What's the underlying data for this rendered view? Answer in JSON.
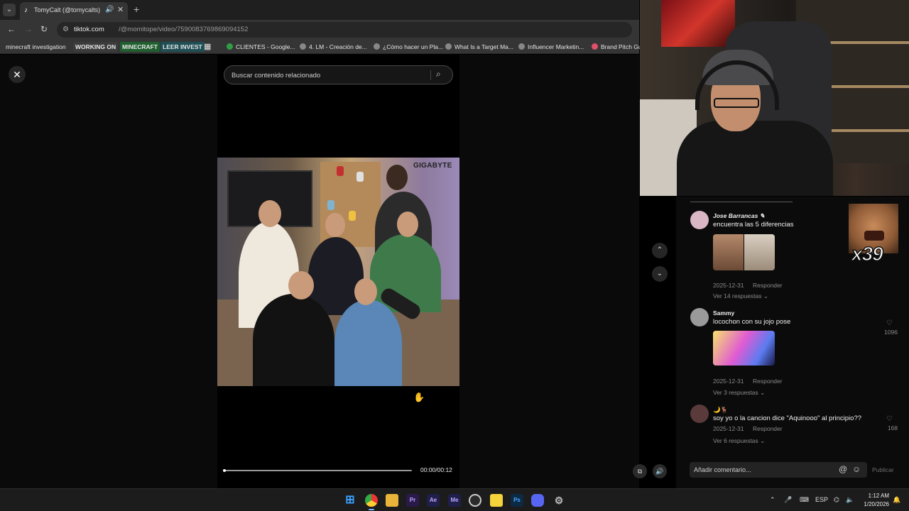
{
  "browser": {
    "tab_title": "TomyCalt (@tomycalts) | Ti",
    "url_host": "tiktok.com",
    "url_path": "/@momitope/video/7590083769869094152",
    "bookmarks": [
      {
        "label": "minecraft investigation",
        "style": "plain"
      },
      {
        "label": "WORKING ON",
        "style": "tag",
        "color": "#3b3b3b"
      },
      {
        "label": "MINECRAFT",
        "style": "tag",
        "color": "#1f5f2f"
      },
      {
        "label": "LEER INVEST",
        "style": "tag",
        "color": "#1f4f55"
      },
      {
        "label": "CLIENTES - Google...",
        "style": "site"
      },
      {
        "label": "4. LM - Creación de...",
        "style": "site"
      },
      {
        "label": "¿Cómo hacer un Pla...",
        "style": "site"
      },
      {
        "label": "What Is a Target Ma...",
        "style": "site"
      },
      {
        "label": "Influencer Marketin...",
        "style": "site"
      },
      {
        "label": "Brand Pitch Gui",
        "style": "site"
      }
    ]
  },
  "player": {
    "search_placeholder": "Buscar contenido relacionado",
    "brand_overlay": "GIGABYTE",
    "timecode": "00:00/00:12",
    "progress": 0.0
  },
  "comments": [
    {
      "user": "Jose Barrancas",
      "user_suffix": "✎",
      "text": "encuentra las 5 diferencias",
      "date": "2025-12-31",
      "reply_label": "Responder",
      "more_replies": "Ver 14 respuestas",
      "likes": ""
    },
    {
      "user": "Sammy",
      "user_suffix": "",
      "text": "locochon con su jojo pose",
      "date": "2025-12-31",
      "reply_label": "Responder",
      "more_replies": "Ver 3 respuestas",
      "likes": "1096"
    },
    {
      "user": "🌙🦌",
      "user_suffix": "",
      "text": "soy yo o la cancion dice \"Aquinooo\" al principio??",
      "date": "2025-12-31",
      "reply_label": "Responder",
      "more_replies": "Ver 6 respuestas",
      "likes": "168"
    }
  ],
  "overlay_badge": "x39",
  "comment_box": {
    "placeholder": "Añadir comentario...",
    "at_icon": "@",
    "emoji_icon": "☺",
    "publish_label": "Publicar"
  },
  "taskbar": {
    "language": "ESP",
    "time": "1:12 AM",
    "date": "1/20/2026",
    "apps": [
      "start-icon",
      "chrome-icon",
      "file-explorer-icon",
      "premiere-icon",
      "after-effects-icon",
      "media-encoder-icon",
      "obs-icon",
      "sticky-notes-icon",
      "photoshop-icon",
      "discord-icon",
      "settings-icon"
    ]
  }
}
